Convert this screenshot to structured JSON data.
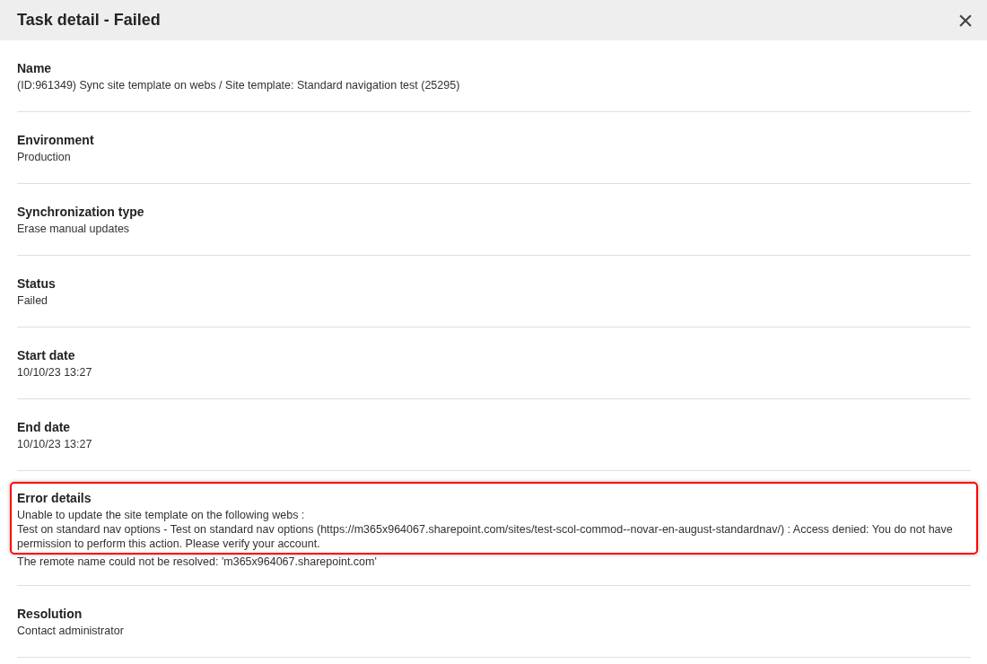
{
  "window": {
    "title": "Task detail - Failed",
    "close": "×"
  },
  "fields": [
    {
      "label": "Name",
      "highlighted": false,
      "lines": [
        "(ID:961349) Sync site template on webs / Site template: Standard navigation test (25295)"
      ]
    },
    {
      "label": "Environment",
      "highlighted": false,
      "lines": [
        "Production"
      ]
    },
    {
      "label": "Synchronization type",
      "highlighted": false,
      "lines": [
        "Erase manual updates"
      ]
    },
    {
      "label": "Status",
      "highlighted": false,
      "lines": [
        "Failed"
      ]
    },
    {
      "label": "Start date",
      "highlighted": false,
      "lines": [
        "10/10/23 13:27"
      ]
    },
    {
      "label": "End date",
      "highlighted": false,
      "lines": [
        "10/10/23 13:27"
      ]
    },
    {
      "label": "Error details",
      "highlighted": true,
      "lines": [
        "Unable to update the site template on the following webs :",
        "Test on standard nav options - Test on standard nav options (https://m365x964067.sharepoint.com/sites/test-scol-commod--novar-en-august-standardnav/) : Access denied: You do not have permission to perform this action. Please verify your account."
      ],
      "trailing_lines": [
        "The remote name could not be resolved: 'm365x964067.sharepoint.com'"
      ]
    },
    {
      "label": "Resolution",
      "highlighted": false,
      "lines": [
        "Contact administrator"
      ]
    }
  ]
}
